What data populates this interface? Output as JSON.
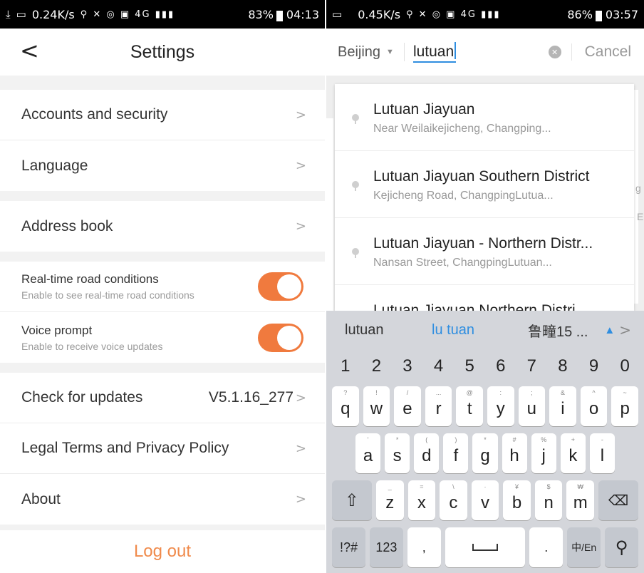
{
  "left": {
    "status": {
      "speed": "0.24K/s",
      "network": "4G",
      "battery": "83%",
      "time": "04:13"
    },
    "nav": {
      "back": "<",
      "title": "Settings"
    },
    "items": {
      "accounts": "Accounts and security",
      "language": "Language",
      "address_book": "Address book",
      "road": {
        "title": "Real-time road conditions",
        "desc": "Enable to see real-time road conditions",
        "on": true
      },
      "voice": {
        "title": "Voice prompt",
        "desc": "Enable to receive voice updates",
        "on": true
      },
      "updates": {
        "label": "Check for updates",
        "version": "V5.1.16_277"
      },
      "legal": "Legal Terms and Privacy Policy",
      "about": "About"
    },
    "chevron": ">",
    "logout": "Log out",
    "accent": "#f07a3e"
  },
  "right": {
    "status": {
      "speed": "0.45K/s",
      "network": "4G",
      "battery": "86%",
      "time": "03:57"
    },
    "search": {
      "city": "Beijing",
      "query": "lutuan",
      "cancel": "Cancel"
    },
    "results": [
      {
        "name": "Lutuan Jiayuan",
        "address": "Near Weilaikejicheng, Changping..."
      },
      {
        "name": "Lutuan Jiayuan Southern District",
        "address": "Kejicheng Road, ChangpingLutua..."
      },
      {
        "name": "Lutuan Jiayuan - Northern Distr...",
        "address": "Nansan Street, ChangpingLutuan..."
      },
      {
        "name": "Lutuan Jiayuan Northern Distri...",
        "address": ""
      }
    ],
    "map_labels": [
      "g",
      "E"
    ],
    "keyboard": {
      "suggestions": [
        "lutuan",
        "lu tuan",
        "鲁疃15 ..."
      ],
      "more": ">",
      "numbers": [
        "1",
        "2",
        "3",
        "4",
        "5",
        "6",
        "7",
        "8",
        "9",
        "0"
      ],
      "row1": [
        [
          "q",
          "?"
        ],
        [
          "w",
          "!"
        ],
        [
          "e",
          "/"
        ],
        [
          "r",
          "..."
        ],
        [
          "t",
          "@"
        ],
        [
          "y",
          ":"
        ],
        [
          "u",
          ";"
        ],
        [
          "i",
          "&"
        ],
        [
          "o",
          "^"
        ],
        [
          "p",
          "~"
        ]
      ],
      "row2": [
        [
          "a",
          "'"
        ],
        [
          "s",
          "*"
        ],
        [
          "d",
          "("
        ],
        [
          "f",
          ")"
        ],
        [
          "g",
          "*"
        ],
        [
          "h",
          "#"
        ],
        [
          "j",
          "%"
        ],
        [
          "k",
          "+"
        ],
        [
          "l",
          "-"
        ]
      ],
      "row3": [
        [
          "z",
          "_"
        ],
        [
          "x",
          "="
        ],
        [
          "c",
          "\\"
        ],
        [
          "v",
          "·"
        ],
        [
          "b",
          "¥"
        ],
        [
          "n",
          "$"
        ],
        [
          "m",
          "₩"
        ]
      ],
      "shift": "⇧",
      "backspace": "⌫",
      "symbols": "!?#",
      "num": "123",
      "comma": ",",
      "period": ".",
      "lang": "中/En",
      "search": "⚲"
    },
    "accent": "#2f8ee0"
  }
}
